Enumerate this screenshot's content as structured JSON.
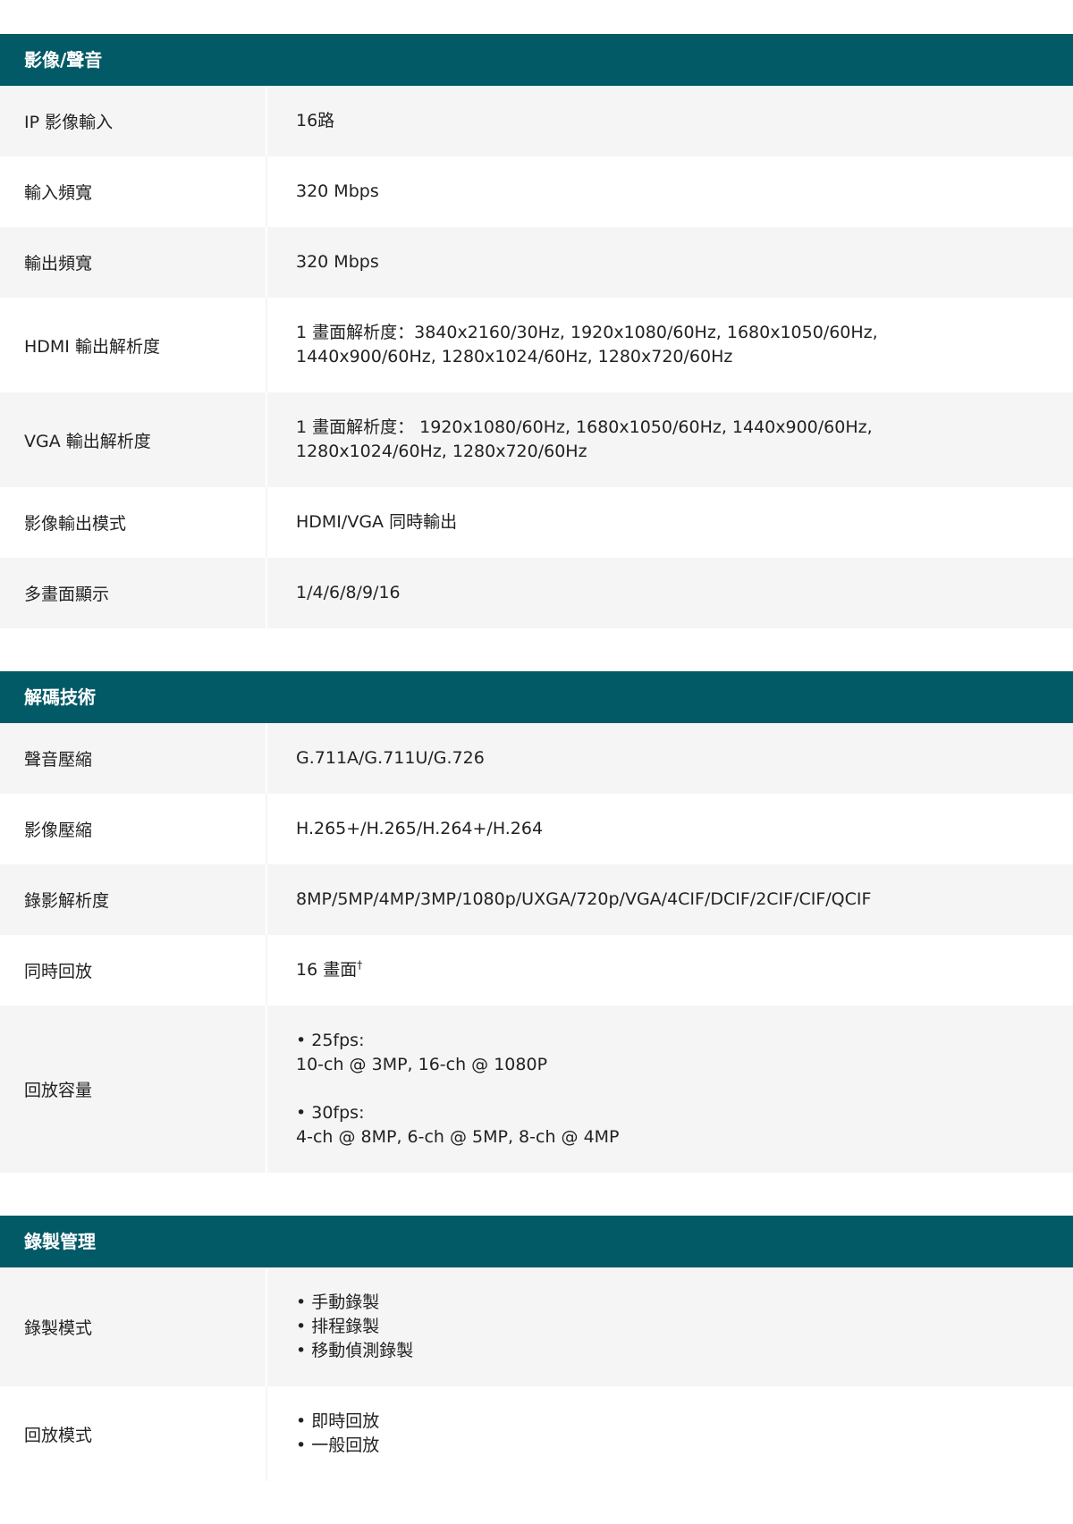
{
  "sections": [
    {
      "title": "影像/聲音",
      "rows": [
        {
          "label": "IP 影像輸入",
          "lines": [
            "16路"
          ]
        },
        {
          "label": "輸入頻寬",
          "lines": [
            "320 Mbps"
          ]
        },
        {
          "label": "輸出頻寬",
          "lines": [
            "320 Mbps"
          ]
        },
        {
          "label": "HDMI 輸出解析度",
          "lines": [
            "1 畫面解析度：3840x2160/30Hz, 1920x1080/60Hz, 1680x1050/60Hz, 1440x900/60Hz, 1280x1024/60Hz, 1280x720/60Hz"
          ]
        },
        {
          "label": "VGA 輸出解析度",
          "lines": [
            "1 畫面解析度： 1920x1080/60Hz, 1680x1050/60Hz, 1440x900/60Hz, 1280x1024/60Hz, 1280x720/60Hz"
          ]
        },
        {
          "label": "影像輸出模式",
          "lines": [
            "HDMI/VGA 同時輸出"
          ]
        },
        {
          "label": "多畫面顯示",
          "lines": [
            "1/4/6/8/9/16"
          ]
        }
      ]
    },
    {
      "title": "解碼技術",
      "rows": [
        {
          "label": "聲音壓縮",
          "lines": [
            "G.711A/G.711U/G.726"
          ]
        },
        {
          "label": "影像壓縮",
          "lines": [
            "H.265+/H.265/H.264+/H.264"
          ]
        },
        {
          "label": "錄影解析度",
          "lines": [
            "8MP/5MP/4MP/3MP/1080p/UXGA/720p/VGA/4CIF/DCIF/2CIF/CIF/QCIF"
          ]
        },
        {
          "label": "同時回放",
          "lines": [
            "16 畫面"
          ],
          "sup": "†"
        },
        {
          "label": "回放容量",
          "lines": [
            "• 25fps:",
            "10-ch @ 3MP, 16-ch @ 1080P",
            "",
            "• 30fps:",
            "4-ch @ 8MP, 6-ch @ 5MP, 8-ch @ 4MP"
          ]
        }
      ]
    },
    {
      "title": "錄製管理",
      "rows": [
        {
          "label": "錄製模式",
          "lines": [
            "• 手動錄製",
            "• 排程錄製",
            "• 移動偵測錄製"
          ]
        },
        {
          "label": "回放模式",
          "lines": [
            "• 即時回放",
            "• 一般回放"
          ]
        }
      ]
    }
  ]
}
